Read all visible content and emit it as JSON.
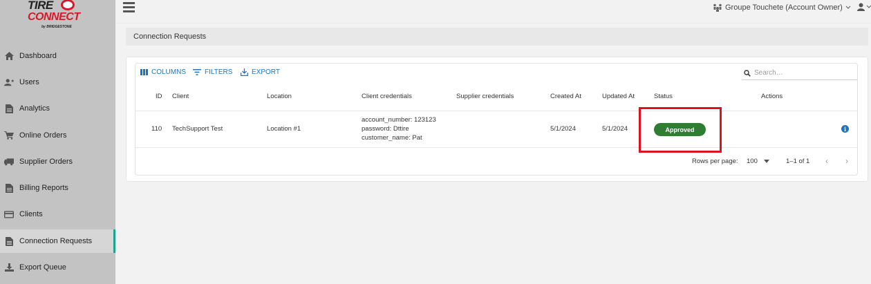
{
  "brand": {
    "line1": "TIRE",
    "line2": "CONNECT",
    "line3": "by BRIDGESTONE"
  },
  "sidebar": {
    "items": [
      {
        "label": "Dashboard",
        "icon": "home-icon"
      },
      {
        "label": "Users",
        "icon": "user-plus-icon"
      },
      {
        "label": "Analytics",
        "icon": "document-icon"
      },
      {
        "label": "Online Orders",
        "icon": "cart-icon"
      },
      {
        "label": "Supplier Orders",
        "icon": "truck-icon"
      },
      {
        "label": "Billing Reports",
        "icon": "document-icon"
      },
      {
        "label": "Clients",
        "icon": "credit-card-icon"
      },
      {
        "label": "Connection Requests",
        "icon": "document-icon",
        "active": true
      },
      {
        "label": "Export Queue",
        "icon": "download-icon"
      }
    ],
    "accent": "#1aa58a"
  },
  "topbar": {
    "account": "Groupe Touchete (Account Owner)"
  },
  "page": {
    "breadcrumb": "Connection Requests"
  },
  "toolbar": {
    "columns": "COLUMNS",
    "filters": "FILTERS",
    "export": "EXPORT",
    "search_placeholder": "Search…"
  },
  "table": {
    "headers": {
      "id": "ID",
      "client": "Client",
      "location": "Location",
      "client_credentials": "Client credentials",
      "supplier_credentials": "Supplier credentials",
      "created_at": "Created At",
      "updated_at": "Updated At",
      "status": "Status",
      "actions": "Actions"
    },
    "rows": [
      {
        "id": "110",
        "client": "TechSupport Test",
        "location": "Location #1",
        "credentials": [
          "account_number: 123123",
          "password: Dttire",
          "customer_name: Pat"
        ],
        "supplier_credentials": "",
        "created_at": "5/1/2024",
        "updated_at": "5/1/2024",
        "status": "Approved"
      }
    ],
    "status_color": "#2e7d32"
  },
  "pagination": {
    "rows_per_page_label": "Rows per page:",
    "rows_per_page": "100",
    "range": "1–1 of 1"
  },
  "highlight_color": "#e0101f",
  "link_color": "#1b74c6"
}
